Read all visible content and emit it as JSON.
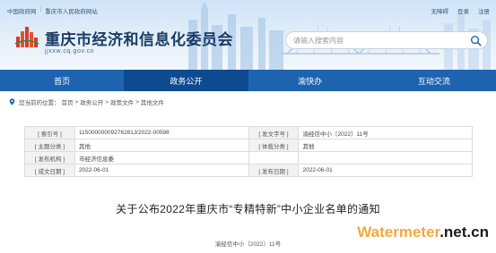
{
  "top_links": [
    "中国政府网",
    "重庆市人民政府网站"
  ],
  "top_links_separator": "|",
  "user_links": [
    "无障碍",
    "登录",
    "注册"
  ],
  "site": {
    "title": "重庆市经济和信息化委员会",
    "domain": "jjxxw.cq.gov.cn"
  },
  "search": {
    "placeholder": "请输入搜索内容",
    "icon": "search-icon"
  },
  "nav": {
    "items": [
      "首页",
      "政务公开",
      "渝快办",
      "互动交流"
    ],
    "active_index": 1,
    "color": "#1d63b0",
    "active_color": "#0e4a8f"
  },
  "breadcrumb": {
    "prefix": "您当前的位置：",
    "items": [
      "首页",
      "政务公开",
      "政策文件",
      "其他文件"
    ],
    "separator": ">"
  },
  "info_table": {
    "rows": [
      [
        "[ 索引号 ]",
        "11500000009276281J/2022-00598",
        "[ 发文字号 ]",
        "渝经信中小〔2022〕11号"
      ],
      [
        "[ 主题分类 ]",
        "其他",
        "[ 体裁分类 ]",
        "其他"
      ],
      [
        "[ 发布机构 ]",
        "市经济信息委",
        "",
        ""
      ],
      [
        "[ 成文日期 ]",
        "2022-06-01",
        "[ 发布日期 ]",
        "2022-06-01"
      ]
    ]
  },
  "article": {
    "title": "关于公布2022年重庆市“专精特新”中小企业名单的通知",
    "doc_number": "渝经信中小〔2022〕11号"
  },
  "watermark": {
    "part1": "Watermeter",
    "part2": ".net.cn"
  }
}
